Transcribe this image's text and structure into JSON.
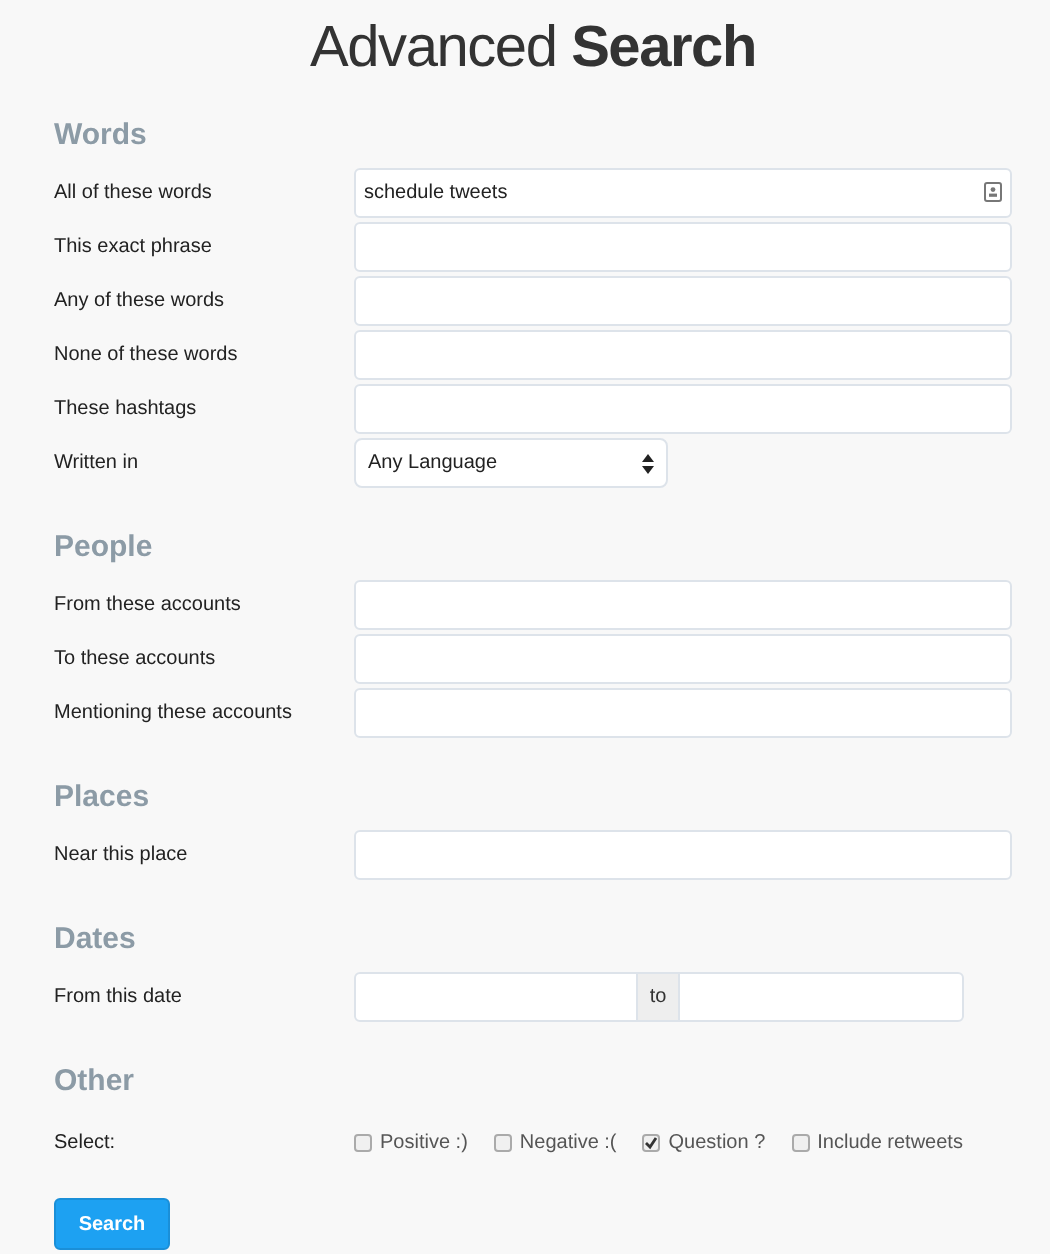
{
  "title": "Advanced **Search**",
  "sections": [
    {
      "heading": "Words",
      "rows": [
        {
          "kind": "text",
          "label": "All of these words",
          "value": "schedule tweets",
          "contact_icon": true
        },
        {
          "kind": "text",
          "label": "This exact phrase"
        },
        {
          "kind": "text",
          "label": "Any of these words"
        },
        {
          "kind": "text",
          "label": "None of these words"
        },
        {
          "kind": "text",
          "label": "These hashtags"
        },
        {
          "kind": "select",
          "label": "Written in",
          "value": "Any Language"
        }
      ]
    },
    {
      "heading": "People",
      "rows": [
        {
          "kind": "text",
          "label": "From these accounts"
        },
        {
          "kind": "text",
          "label": "To these accounts"
        },
        {
          "kind": "text",
          "label": "Mentioning these accounts"
        }
      ]
    },
    {
      "heading": "Places",
      "rows": [
        {
          "kind": "text",
          "label": "Near this place"
        }
      ]
    },
    {
      "heading": "Dates",
      "rows": [
        {
          "kind": "date_range",
          "label": "From this date",
          "separator": "to"
        }
      ]
    },
    {
      "heading": "Other",
      "rows": [
        {
          "kind": "checkboxes",
          "label": "Select:",
          "options": [
            {
              "label": "Positive :)",
              "checked": false
            },
            {
              "label": "Negative :(",
              "checked": false
            },
            {
              "label": "Question ?",
              "checked": true
            },
            {
              "label": "Include retweets",
              "checked": false
            }
          ]
        }
      ]
    }
  ],
  "button": "Search"
}
